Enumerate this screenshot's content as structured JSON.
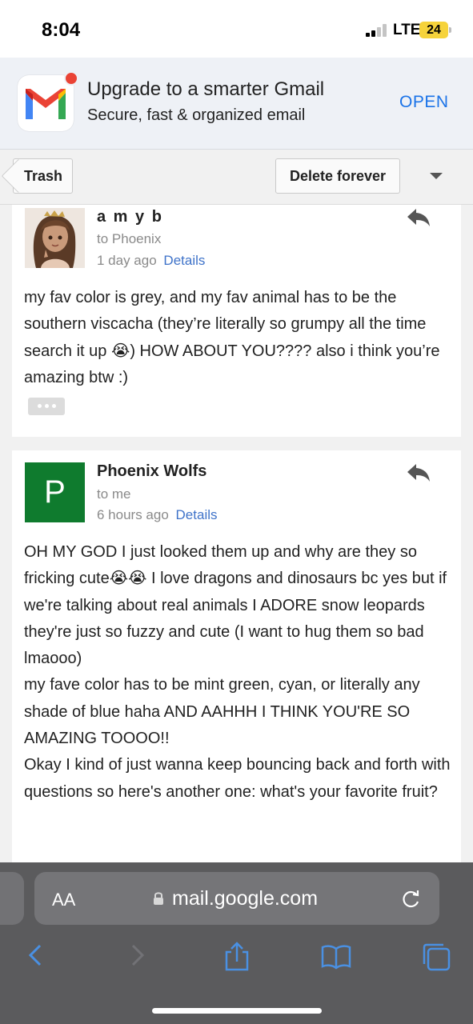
{
  "status_bar": {
    "time": "8:04",
    "network": "LTE",
    "battery": "24"
  },
  "promo": {
    "title": "Upgrade to a smarter Gmail",
    "subtitle": "Secure, fast & organized email",
    "open_label": "OPEN",
    "icon": "gmail-logo-icon"
  },
  "toolbar": {
    "back_label": "Trash",
    "delete_label": "Delete forever",
    "more_icon": "caret-down-icon"
  },
  "messages": [
    {
      "sender": "a m y b",
      "recipient": "to Phoenix",
      "time": "1 day ago",
      "details_label": "Details",
      "body": [
        "my fav color is grey, and my fav animal has to be the southern viscacha (they’re literally so grumpy all the time search it up 😭) HOW ABOUT YOU???? also i think you’re amazing btw :)"
      ],
      "more_label": "•••"
    },
    {
      "sender": "Phoenix Wolfs",
      "avatar_letter": "P",
      "recipient": "to me",
      "time": "6 hours ago",
      "details_label": "Details",
      "body": [
        "OH MY GOD I just looked them up and why are they so fricking cute😭😭 I love dragons and dinosaurs bc yes but if we're talking about real animals I ADORE snow leopards they're just so fuzzy and cute (I want to hug them so bad lmaooo)",
        "my fave color has to be mint green, cyan, or literally any shade of blue haha AND AAHHH I THINK YOU'RE SO AMAZING TOOOO!!",
        "Okay I kind of just wanna keep bouncing back and forth with questions so here's another one: what's your favorite fruit?"
      ]
    }
  ],
  "browser": {
    "text_size_label": "AA",
    "url": "mail.google.com"
  },
  "colors": {
    "accent_blue": "#1a73e8",
    "link_blue": "#3f73c9",
    "avatar_green": "#0f7b2e",
    "safari_toolbar": "#5b5b5d",
    "toolbar_icon_blue": "#4a90e2"
  }
}
